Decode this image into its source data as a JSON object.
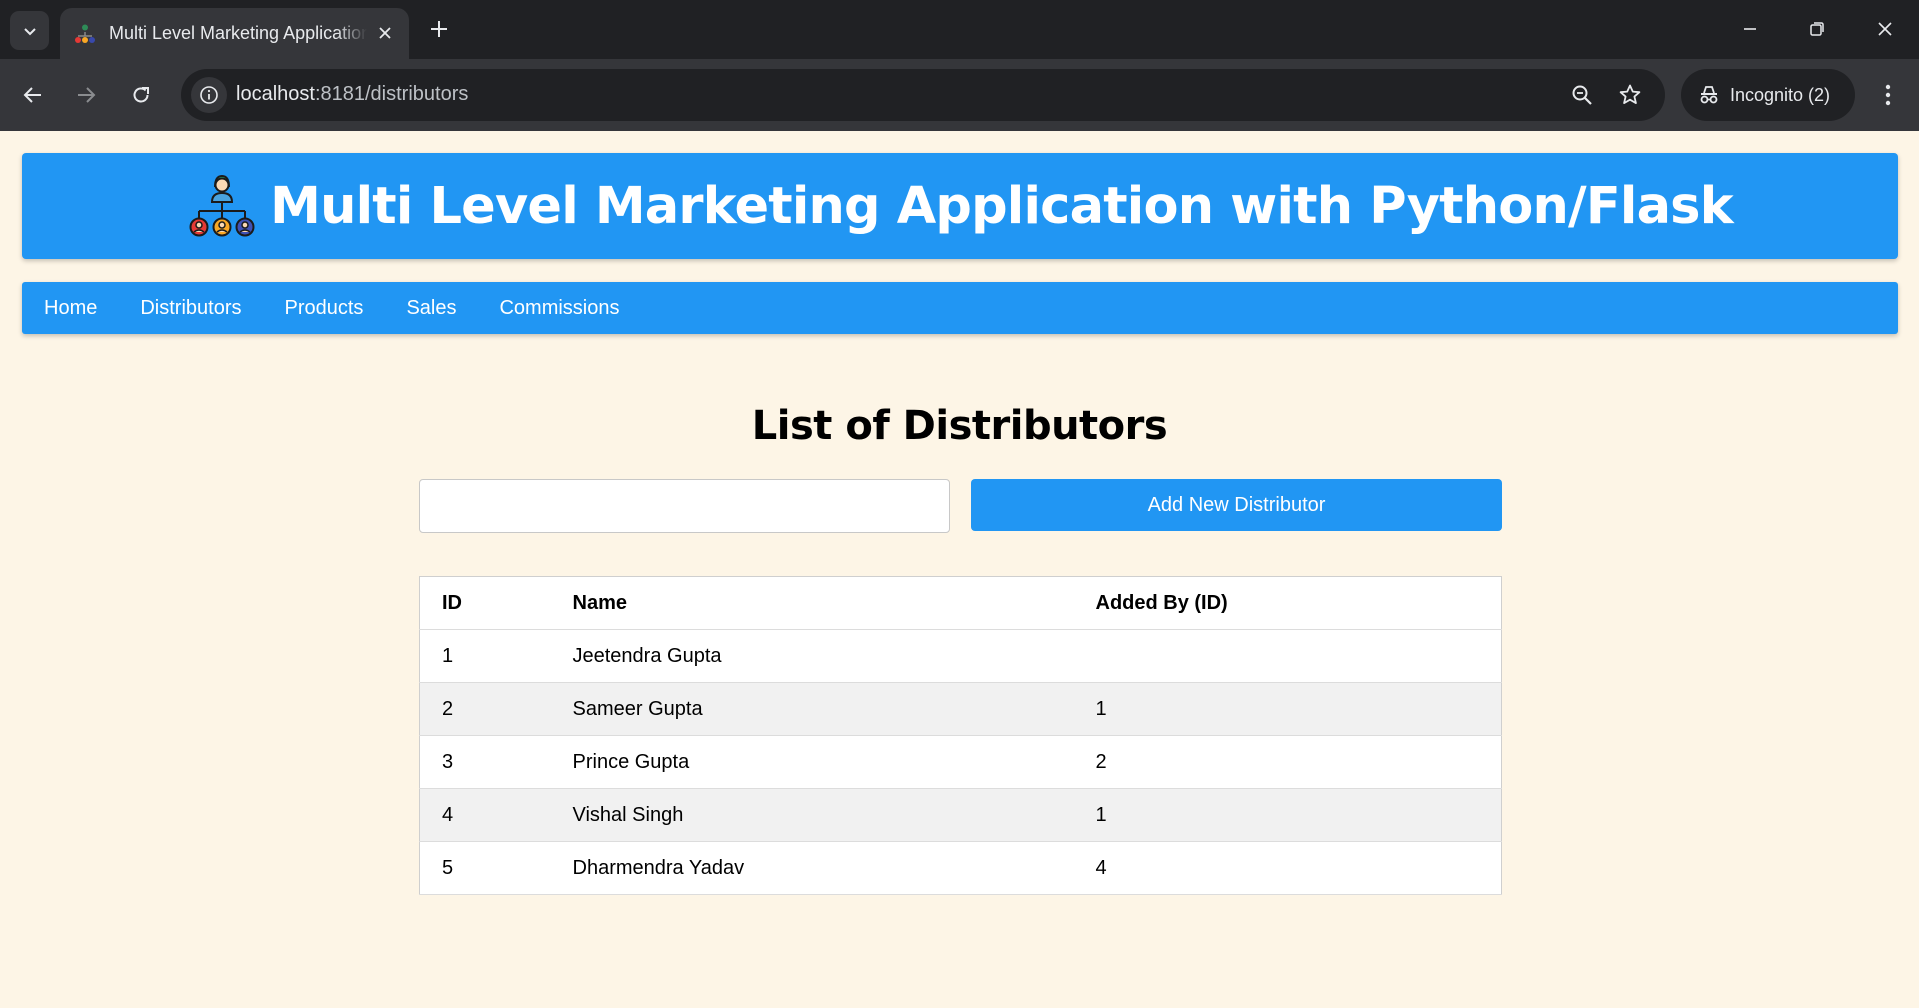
{
  "browser": {
    "tab_title": "Multi Level Marketing Application with Python/Flask",
    "url_host": "localhost",
    "url_path": ":8181/distributors",
    "incognito_label": "Incognito (2)"
  },
  "app": {
    "title": "Multi Level Marketing Application with Python/Flask",
    "accent_color": "#2196f3",
    "background_color": "#fdf5e6"
  },
  "nav": {
    "items": [
      "Home",
      "Distributors",
      "Products",
      "Sales",
      "Commissions"
    ]
  },
  "main": {
    "heading": "List of Distributors",
    "search_value": "",
    "search_placeholder": "",
    "add_button_label": "Add New Distributor"
  },
  "table": {
    "columns": [
      "ID",
      "Name",
      "Added By (ID)"
    ],
    "rows": [
      [
        "1",
        "Jeetendra Gupta",
        ""
      ],
      [
        "2",
        "Sameer Gupta",
        "1"
      ],
      [
        "3",
        "Prince Gupta",
        "2"
      ],
      [
        "4",
        "Vishal Singh",
        "1"
      ],
      [
        "5",
        "Dharmendra Yadav",
        "4"
      ]
    ]
  }
}
